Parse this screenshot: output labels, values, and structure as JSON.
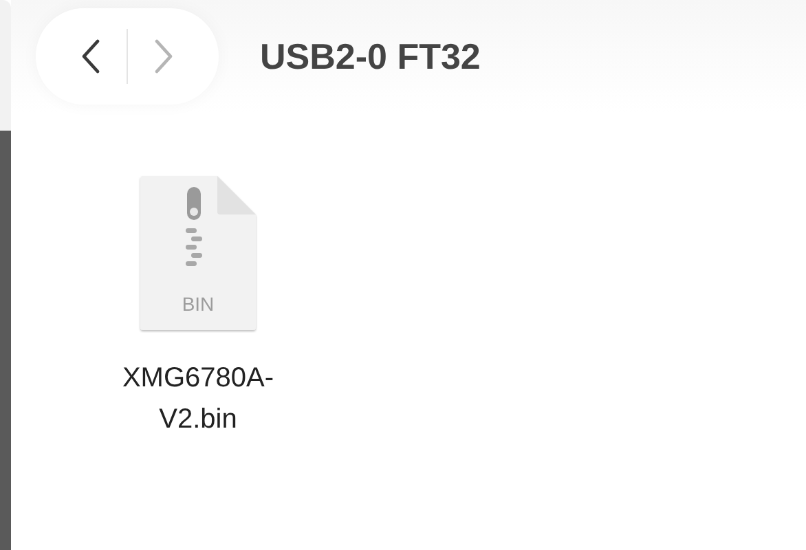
{
  "toolbar": {
    "back": {
      "disabled": false
    },
    "forward": {
      "disabled": true
    },
    "title": "USB2-0 FT32"
  },
  "files": [
    {
      "name": "XMG6780A-\nV2.bin",
      "type_label": "BIN",
      "selected": false
    }
  ]
}
